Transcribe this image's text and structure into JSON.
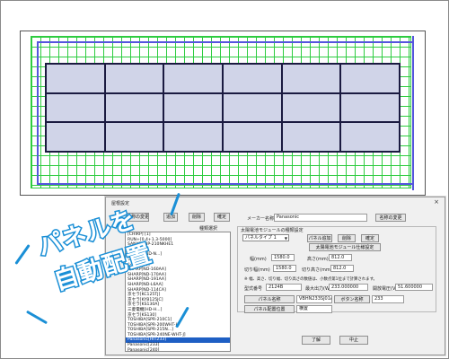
{
  "drawing": {
    "panel_grid": {
      "rows": 3,
      "cols": 6
    }
  },
  "dialog": {
    "title": "屋根設定",
    "close_label": "×",
    "buttons_top": [
      "名称の変更",
      "追加",
      "削除",
      "確定"
    ],
    "list_header": "種類選択",
    "list_items": [
      "[CHIRP] [1]",
      "RUN+[0.4+1.3-5000]",
      "SANYO-HIP-210NKHE1",
      "SANYO[1]",
      "シャープ[ND-N...]",
      "シャープ[2]",
      "シャープ[3]",
      "SHARP[ND-160AA]",
      "SHARP[ND-170AA]",
      "SHARP[ND-191AA]",
      "SHARP[ND-L6AA]",
      "SHARP[ND-114CA]",
      "京セラ[KC125TJ]",
      "京セラ[KYB125JC]",
      "京セラ[KS130A]",
      "三菱電機[HD-H...]",
      "京セラ[KS130]",
      "TOSHIBA[SPR-210C1]",
      "TOSHIBA[SPR-200WHT-J]",
      "TOSHIBA[SPR-215N...]",
      "TOSHIBA[SPR-240NE-WHT-J]",
      "Panasonic[HIT233]",
      "Panasonic[233]",
      "Panasonic[240]"
    ],
    "selected_index": 21,
    "maker_label": "メーカー名称",
    "maker_value": "Panasonic",
    "name_change_btn": "名称の変更",
    "module_group_label": "太陽電池モジュールの種類設定",
    "panel_type_value": "パネルタイプ 1",
    "panel_buttons": [
      "パネル追加",
      "削除",
      "確定"
    ],
    "spec_btn": "太陽電池モジュール仕様設定",
    "width_label": "幅(mm)",
    "width_value": "1580.0",
    "height_label": "高さ(mm)",
    "height_value": "812.0",
    "cut_width_label": "切り幅(mm)",
    "cut_width_value": "1580.0",
    "cut_height_label": "切り高さ(mm)",
    "cut_height_value": "812.0",
    "note": "※ 幅、高さ、切り幅、切り高さの数値は、小数点第1位まで計算されます。",
    "model_label": "型式番号",
    "model_value": "2124B",
    "max_output_label": "最大出力(W)",
    "max_output_value": "233.000000",
    "open_voltage_label": "開放電圧(V)",
    "open_voltage_value": "51.600000",
    "panel_name_label": "パネル名称",
    "panel_name_value": "VBHN233SJ01A",
    "unit_name_label": "ボタン名称",
    "unit_name_value": "233",
    "place_label": "パネル配置位置",
    "place_value": "横置",
    "ok_label": "了解",
    "cancel_label": "中止"
  },
  "callout": {
    "line1": "パネルを",
    "line2": "自動配置",
    "color": "#1a8fd6"
  }
}
